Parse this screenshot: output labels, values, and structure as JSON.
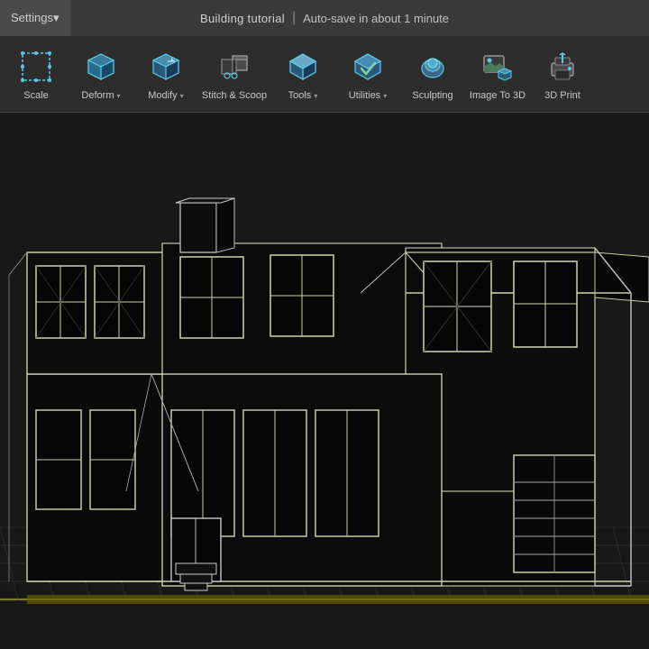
{
  "titlebar": {
    "settings_label": "Settings▾",
    "project_name": "Building tutorial",
    "separator": "|",
    "autosave_text": "Auto-save in about 1 minute"
  },
  "toolbar": {
    "items": [
      {
        "id": "scale",
        "label": "Scale",
        "has_dropdown": false
      },
      {
        "id": "deform",
        "label": "Deform",
        "has_dropdown": true
      },
      {
        "id": "modify",
        "label": "Modify",
        "has_dropdown": true
      },
      {
        "id": "stitch-scoop",
        "label": "Stitch & Scoop",
        "has_dropdown": false
      },
      {
        "id": "tools",
        "label": "Tools",
        "has_dropdown": true
      },
      {
        "id": "utilities",
        "label": "Utilities",
        "has_dropdown": true
      },
      {
        "id": "sculpting",
        "label": "Sculpting",
        "has_dropdown": false
      },
      {
        "id": "image-to-3d",
        "label": "Image To 3D",
        "has_dropdown": false
      },
      {
        "id": "3d-print",
        "label": "3D Print",
        "has_dropdown": false
      }
    ]
  },
  "viewport": {
    "background_color": "#1a1a1a"
  }
}
